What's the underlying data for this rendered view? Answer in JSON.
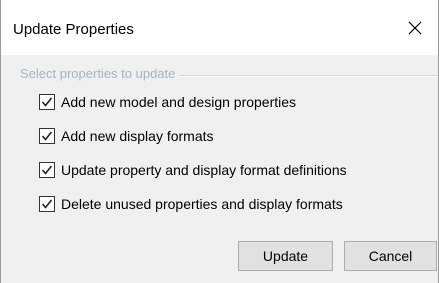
{
  "window": {
    "title": "Update Properties",
    "close_icon": "close-icon"
  },
  "group": {
    "label": "Select properties to update"
  },
  "options": [
    {
      "label": "Add new model and design properties",
      "checked": true
    },
    {
      "label": "Add new display formats",
      "checked": true
    },
    {
      "label": "Update property and display format definitions",
      "checked": true
    },
    {
      "label": "Delete unused properties and display formats",
      "checked": true
    }
  ],
  "buttons": {
    "update_label": "Update",
    "cancel_label": "Cancel"
  },
  "colors": {
    "group_label": "#a3b3c8",
    "dialog_bg": "#f0f0f0",
    "titlebar_bg": "#ffffff"
  }
}
